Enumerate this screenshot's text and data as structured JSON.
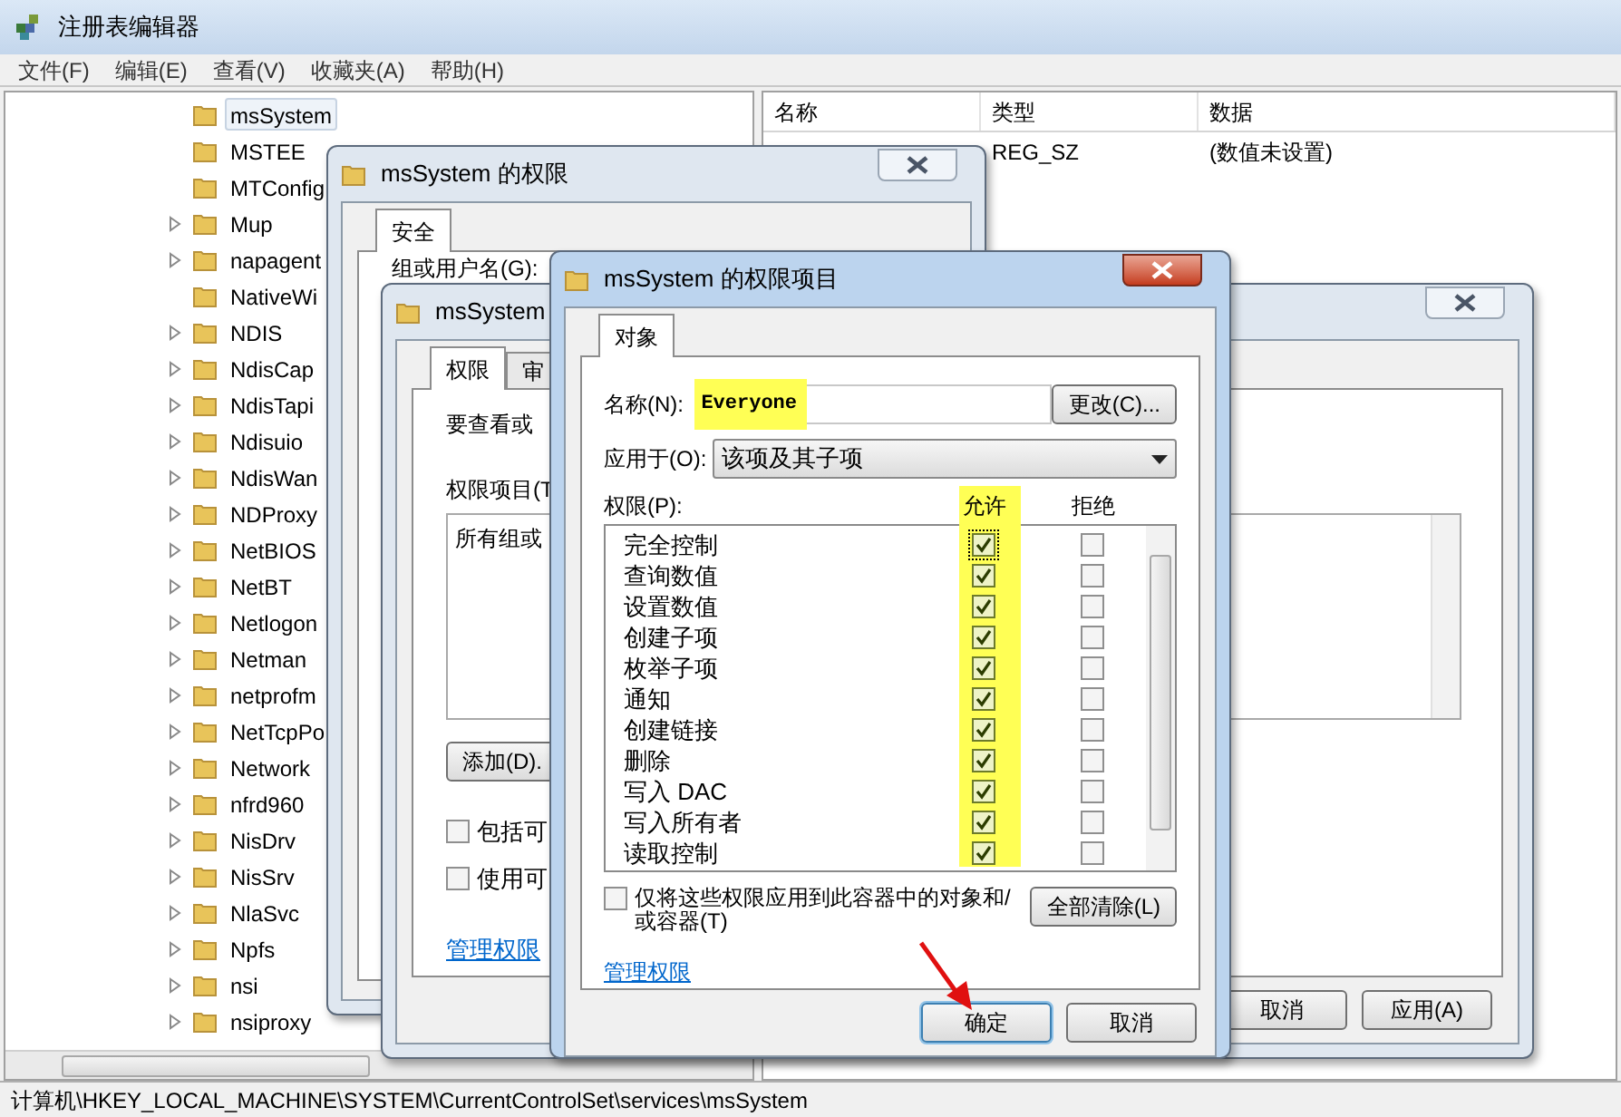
{
  "regedit": {
    "title": "注册表编辑器",
    "menu": [
      "文件(F)",
      "编辑(E)",
      "查看(V)",
      "收藏夹(A)",
      "帮助(H)"
    ],
    "tree": [
      {
        "label": "msSystem",
        "selected": true,
        "expandable": false
      },
      {
        "label": "MSTEE",
        "selected": false,
        "expandable": false
      },
      {
        "label": "MTConfig",
        "selected": false,
        "expandable": false
      },
      {
        "label": "Mup",
        "selected": false,
        "expandable": true
      },
      {
        "label": "napagent",
        "selected": false,
        "expandable": true
      },
      {
        "label": "NativeWi",
        "selected": false,
        "expandable": false
      },
      {
        "label": "NDIS",
        "selected": false,
        "expandable": true
      },
      {
        "label": "NdisCap",
        "selected": false,
        "expandable": true
      },
      {
        "label": "NdisTapi",
        "selected": false,
        "expandable": true
      },
      {
        "label": "Ndisuio",
        "selected": false,
        "expandable": true
      },
      {
        "label": "NdisWan",
        "selected": false,
        "expandable": true
      },
      {
        "label": "NDProxy",
        "selected": false,
        "expandable": true
      },
      {
        "label": "NetBIOS",
        "selected": false,
        "expandable": true
      },
      {
        "label": "NetBT",
        "selected": false,
        "expandable": true
      },
      {
        "label": "Netlogon",
        "selected": false,
        "expandable": true
      },
      {
        "label": "Netman",
        "selected": false,
        "expandable": true
      },
      {
        "label": "netprofm",
        "selected": false,
        "expandable": true
      },
      {
        "label": "NetTcpPo",
        "selected": false,
        "expandable": true
      },
      {
        "label": "Network",
        "selected": false,
        "expandable": true
      },
      {
        "label": "nfrd960",
        "selected": false,
        "expandable": true
      },
      {
        "label": "NisDrv",
        "selected": false,
        "expandable": true
      },
      {
        "label": "NisSrv",
        "selected": false,
        "expandable": true
      },
      {
        "label": "NlaSvc",
        "selected": false,
        "expandable": true
      },
      {
        "label": "Npfs",
        "selected": false,
        "expandable": true
      },
      {
        "label": "nsi",
        "selected": false,
        "expandable": true
      },
      {
        "label": "nsiproxy",
        "selected": false,
        "expandable": true
      }
    ],
    "list": {
      "columns": [
        "名称",
        "类型",
        "数据"
      ],
      "rows": [
        {
          "type": "REG_SZ",
          "data": "(数值未设置)"
        }
      ]
    },
    "status_bar": "计算机\\HKEY_LOCAL_MACHINE\\SYSTEM\\CurrentControlSet\\services\\msSystem"
  },
  "permissions_dialog": {
    "title": "msSystem 的权限",
    "tabs": [
      {
        "label": "安全",
        "selected": true
      }
    ],
    "group_label": "组或用户名(G):"
  },
  "advanced_dialog": {
    "title": "msSystem",
    "tabs": [
      {
        "label": "权限",
        "selected": true
      },
      {
        "label": "审",
        "selected": false
      }
    ],
    "hint": "要查看或",
    "entries_label": "权限项目(T",
    "entries_header": "所有组或",
    "add_button": "添加(D).",
    "options": [
      {
        "label": "包括可",
        "checked": false
      },
      {
        "label": "使用可",
        "checked": false
      }
    ],
    "link": "管理权限",
    "buttons": [
      "取消",
      "应用(A)"
    ]
  },
  "entry_dialog": {
    "title": "msSystem 的权限项目",
    "tabs": [
      {
        "label": "对象",
        "selected": true
      }
    ],
    "name_label": "名称(N):",
    "name_value": "Everyone",
    "change_button": "更改(C)...",
    "apply_to_label": "应用于(O):",
    "apply_to_value": "该项及其子项",
    "permissions_label": "权限(P):",
    "columns": [
      "允许",
      "拒绝"
    ],
    "permissions": [
      {
        "name": "完全控制",
        "allow": true,
        "deny": false
      },
      {
        "name": "查询数值",
        "allow": true,
        "deny": false
      },
      {
        "name": "设置数值",
        "allow": true,
        "deny": false
      },
      {
        "name": "创建子项",
        "allow": true,
        "deny": false
      },
      {
        "name": "枚举子项",
        "allow": true,
        "deny": false
      },
      {
        "name": "通知",
        "allow": true,
        "deny": false
      },
      {
        "name": "创建链接",
        "allow": true,
        "deny": false
      },
      {
        "name": "删除",
        "allow": true,
        "deny": false
      },
      {
        "name": "写入 DAC",
        "allow": true,
        "deny": false
      },
      {
        "name": "写入所有者",
        "allow": true,
        "deny": false
      },
      {
        "name": "读取控制",
        "allow": true,
        "deny": false
      }
    ],
    "container_only": {
      "label": "仅将这些权限应用到此容器中的对象和/或容器(T)",
      "checked": false
    },
    "clear_button": "全部清除(L)",
    "link": "管理权限",
    "buttons": [
      "确定",
      "取消"
    ]
  }
}
